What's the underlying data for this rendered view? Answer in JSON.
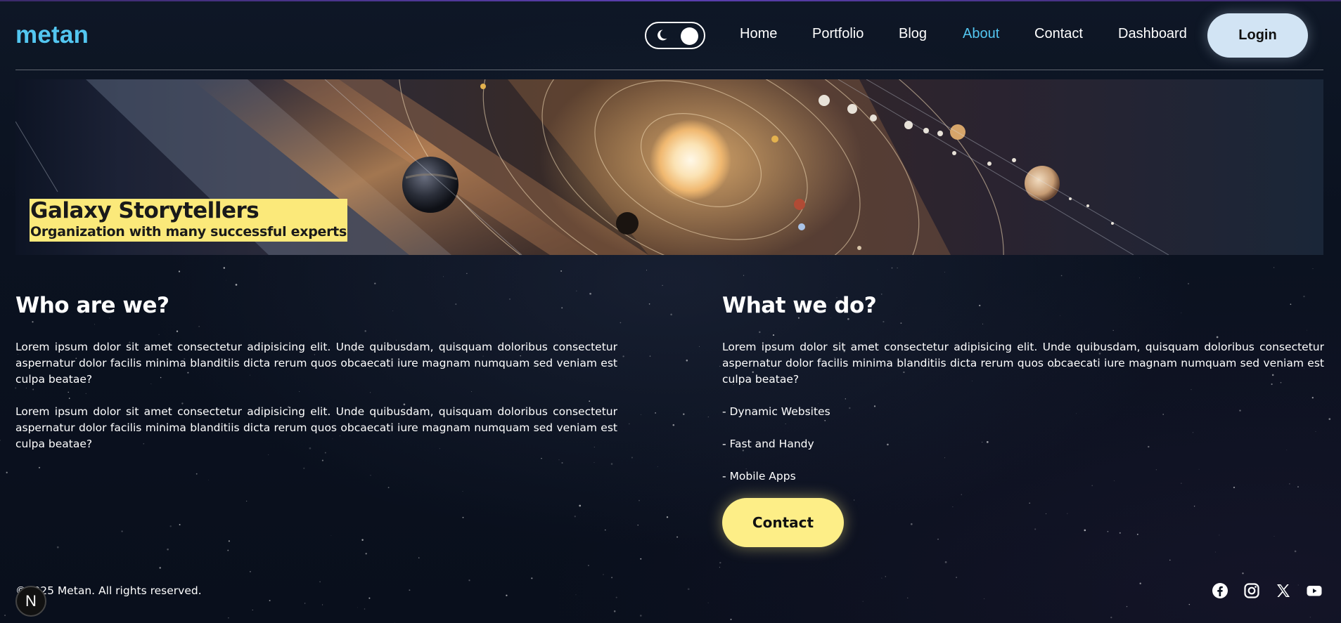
{
  "header": {
    "logo": "metan",
    "nav": [
      "Home",
      "Portfolio",
      "Blog",
      "About",
      "Contact",
      "Dashboard"
    ],
    "active_nav": "About",
    "login_label": "Login"
  },
  "banner": {
    "title": "Galaxy Storytellers",
    "subtitle": "Organization with many successful experts"
  },
  "who": {
    "heading": "Who are we?",
    "paragraphs": [
      "Lorem ipsum dolor sit amet consectetur adipisicing elit. Unde quibusdam, quisquam doloribus consectetur aspernatur dolor facilis minima blanditiis dicta rerum quos obcaecati iure magnam numquam sed veniam est culpa beatae?",
      "Lorem ipsum dolor sit amet consectetur adipisicing elit. Unde quibusdam, quisquam doloribus consectetur aspernatur dolor facilis minima blanditiis dicta rerum quos obcaecati iure magnam numquam sed veniam est culpa beatae?"
    ]
  },
  "what": {
    "heading": "What we do?",
    "paragraph": "Lorem ipsum dolor sit amet consectetur adipisicing elit. Unde quibusdam, quisquam doloribus consectetur aspernatur dolor facilis minima blanditiis dicta rerum quos obcaecati iure magnam numquam sed veniam est culpa beatae?",
    "items": [
      "- Dynamic Websites",
      "- Fast and Handy",
      "- Mobile Apps"
    ],
    "contact_label": "Contact"
  },
  "footer": {
    "copyright": "©2025 Metan. All rights reserved.",
    "badge": "N",
    "social_icons": [
      "facebook-icon",
      "instagram-icon",
      "x-icon",
      "youtube-icon"
    ]
  },
  "colors": {
    "accent": "#53c6f0",
    "yellow": "#fdee87",
    "login_bg": "#d2e4f4",
    "background": "#0b1220"
  }
}
